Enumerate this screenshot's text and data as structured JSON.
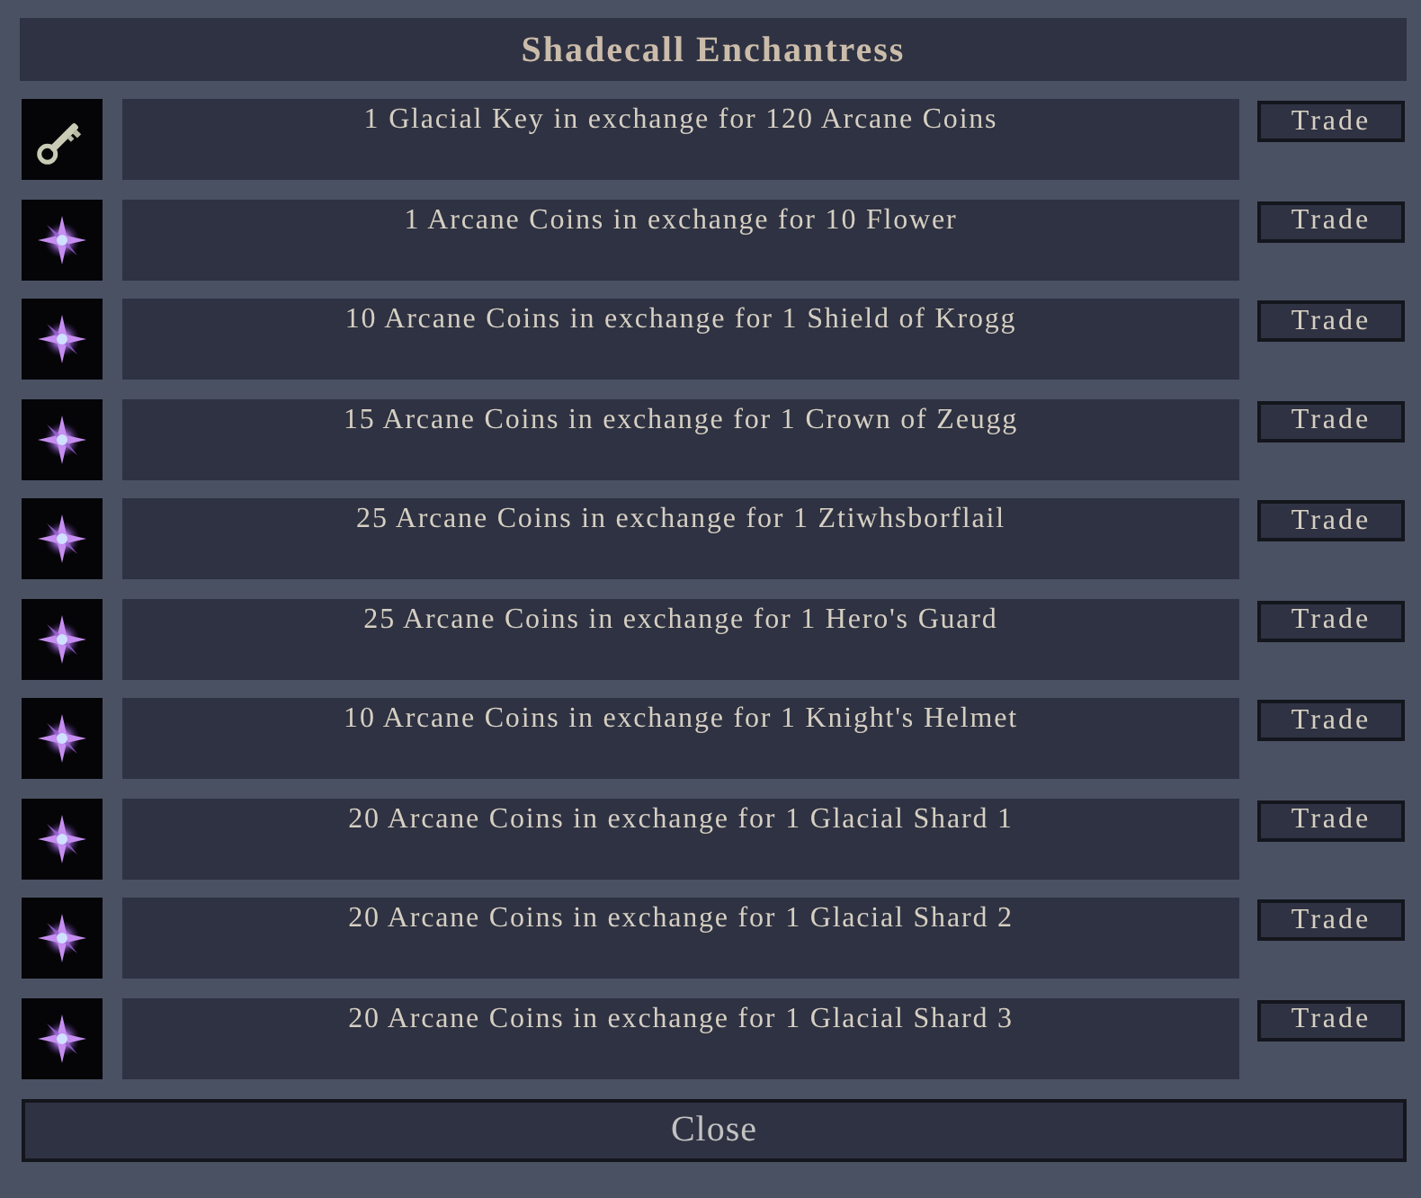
{
  "window": {
    "title": "Shadecall Enchantress"
  },
  "trades": [
    {
      "kind": "key",
      "offer": "1 Glacial Key in exchange for 120 Arcane Coins",
      "button": "Trade"
    },
    {
      "kind": "star",
      "offer": "1 Arcane Coins in exchange for 10 Flower",
      "button": "Trade"
    },
    {
      "kind": "star",
      "offer": "10 Arcane Coins in exchange for 1 Shield of Krogg",
      "button": "Trade"
    },
    {
      "kind": "star",
      "offer": "15 Arcane Coins in exchange for 1 Crown of Zeugg",
      "button": "Trade"
    },
    {
      "kind": "star",
      "offer": "25 Arcane Coins in exchange for 1 Ztiwhsborflail",
      "button": "Trade"
    },
    {
      "kind": "star",
      "offer": "25 Arcane Coins in exchange for 1 Hero's Guard",
      "button": "Trade"
    },
    {
      "kind": "star",
      "offer": "10 Arcane Coins in exchange for 1 Knight's Helmet",
      "button": "Trade"
    },
    {
      "kind": "star",
      "offer": "20 Arcane Coins in exchange for 1 Glacial Shard 1",
      "button": "Trade"
    },
    {
      "kind": "star",
      "offer": "20 Arcane Coins in exchange for 1 Glacial Shard 2",
      "button": "Trade"
    },
    {
      "kind": "star",
      "offer": "20 Arcane Coins in exchange for 1 Glacial Shard 3",
      "button": "Trade"
    }
  ],
  "close_button": "Close"
}
